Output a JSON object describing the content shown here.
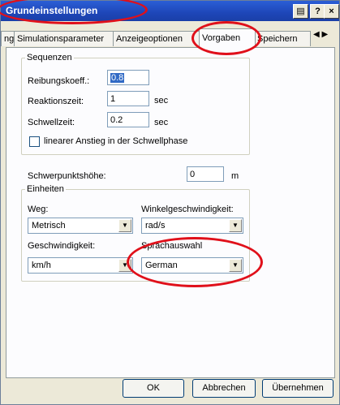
{
  "window": {
    "title": "Grundeinstellungen",
    "help_label": "?",
    "close_label": "×"
  },
  "tabs": [
    {
      "label": "ng"
    },
    {
      "label": "Simulationsparameter"
    },
    {
      "label": "Anzeigeoptionen"
    },
    {
      "label": "Vorgaben"
    },
    {
      "label": "Speichern"
    }
  ],
  "sequenzen": {
    "legend": "Sequenzen",
    "reibung_label": "Reibungskoeff.:",
    "reibung_value": "0.8",
    "reaktion_label": "Reaktionszeit:",
    "reaktion_value": "1",
    "reaktion_unit": "sec",
    "schwell_label": "Schwellzeit:",
    "schwell_value": "0.2",
    "schwell_unit": "sec",
    "linear_label": "linearer Anstieg in der Schwellphase"
  },
  "schwerpunkt": {
    "label": "Schwerpunktshöhe:",
    "value": "0",
    "unit": "m"
  },
  "einheiten": {
    "legend": "Einheiten",
    "weg_label": "Weg:",
    "weg_value": "Metrisch",
    "winkel_label": "Winkelgeschwindigkeit:",
    "winkel_value": "rad/s",
    "geschw_label": "Geschwindigkeit:",
    "geschw_value": "km/h",
    "sprache_label": "Sprachauswahl",
    "sprache_value": "German"
  },
  "buttons": {
    "ok": "OK",
    "cancel": "Abbrechen",
    "apply": "Übernehmen"
  },
  "colors": {
    "titlebar": "#1e46b8",
    "highlight_ring": "#e0101a"
  }
}
